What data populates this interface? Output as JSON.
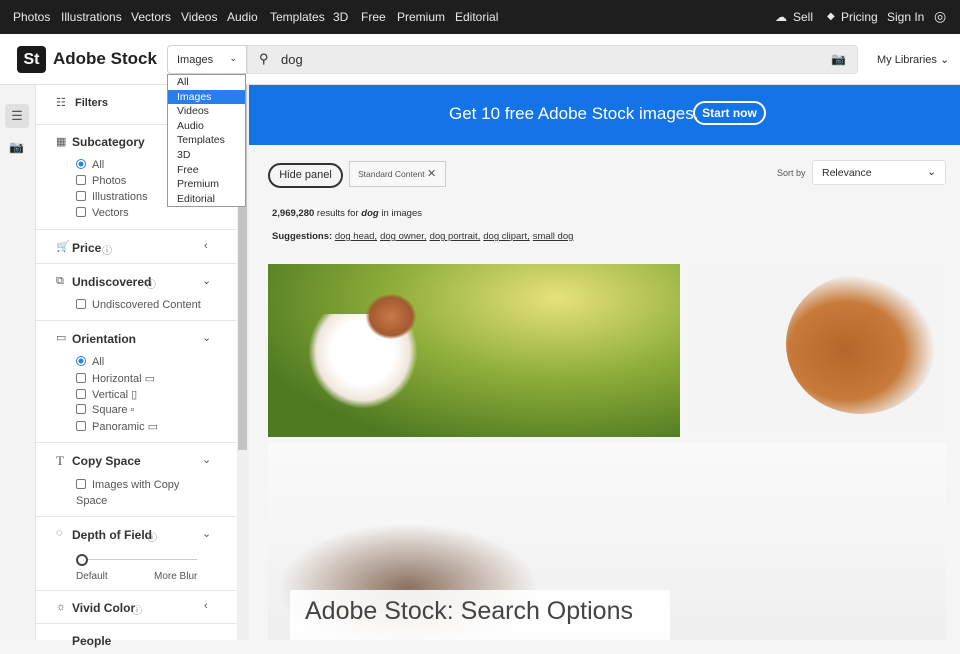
{
  "topnav": {
    "items": [
      "Photos",
      "Illustrations",
      "Vectors",
      "Videos",
      "Audio",
      "Templates",
      "3D",
      "Free",
      "Premium",
      "Editorial"
    ],
    "sell": "Sell",
    "pricing": "Pricing",
    "signin": "Sign In"
  },
  "header": {
    "logo": "St",
    "brand": "Adobe Stock",
    "type_selected": "Images",
    "search_value": "dog",
    "my_libraries": "My Libraries"
  },
  "type_dropdown": {
    "options": [
      "All",
      "Images",
      "Videos",
      "Audio",
      "Templates",
      "3D",
      "Free",
      "Premium",
      "Editorial"
    ],
    "selected": "Images"
  },
  "filters": {
    "title": "Filters",
    "subcategory": {
      "title": "Subcategory",
      "options": [
        "All",
        "Photos",
        "Illustrations",
        "Vectors"
      ]
    },
    "price": {
      "title": "Price"
    },
    "undiscovered": {
      "title": "Undiscovered",
      "option": "Undiscovered Content"
    },
    "orientation": {
      "title": "Orientation",
      "options": [
        "All",
        "Horizontal",
        "Vertical",
        "Square",
        "Panoramic"
      ]
    },
    "copy_space": {
      "title": "Copy Space",
      "option": "Images with Copy Space"
    },
    "depth_of_field": {
      "title": "Depth of Field",
      "min_label": "Default",
      "max_label": "More Blur",
      "value": 0
    },
    "vivid_color": {
      "title": "Vivid Color"
    },
    "people": {
      "title": "People"
    }
  },
  "banner": {
    "text": "Get 10 free Adobe Stock images.",
    "button": "Start now"
  },
  "toolbar": {
    "hide_panel": "Hide panel",
    "chip": "Standard Content",
    "sort_label": "Sort by",
    "sort_value": "Relevance"
  },
  "results": {
    "count": "2,969,280",
    "text_for": " results for ",
    "query": "dog",
    "text_in": " in images"
  },
  "suggestions": {
    "label": "Suggestions:",
    "items": [
      "dog head,",
      "dog owner,",
      "dog portrait,",
      "dog clipart,",
      "small dog"
    ]
  },
  "caption": "Adobe Stock: Search Options"
}
